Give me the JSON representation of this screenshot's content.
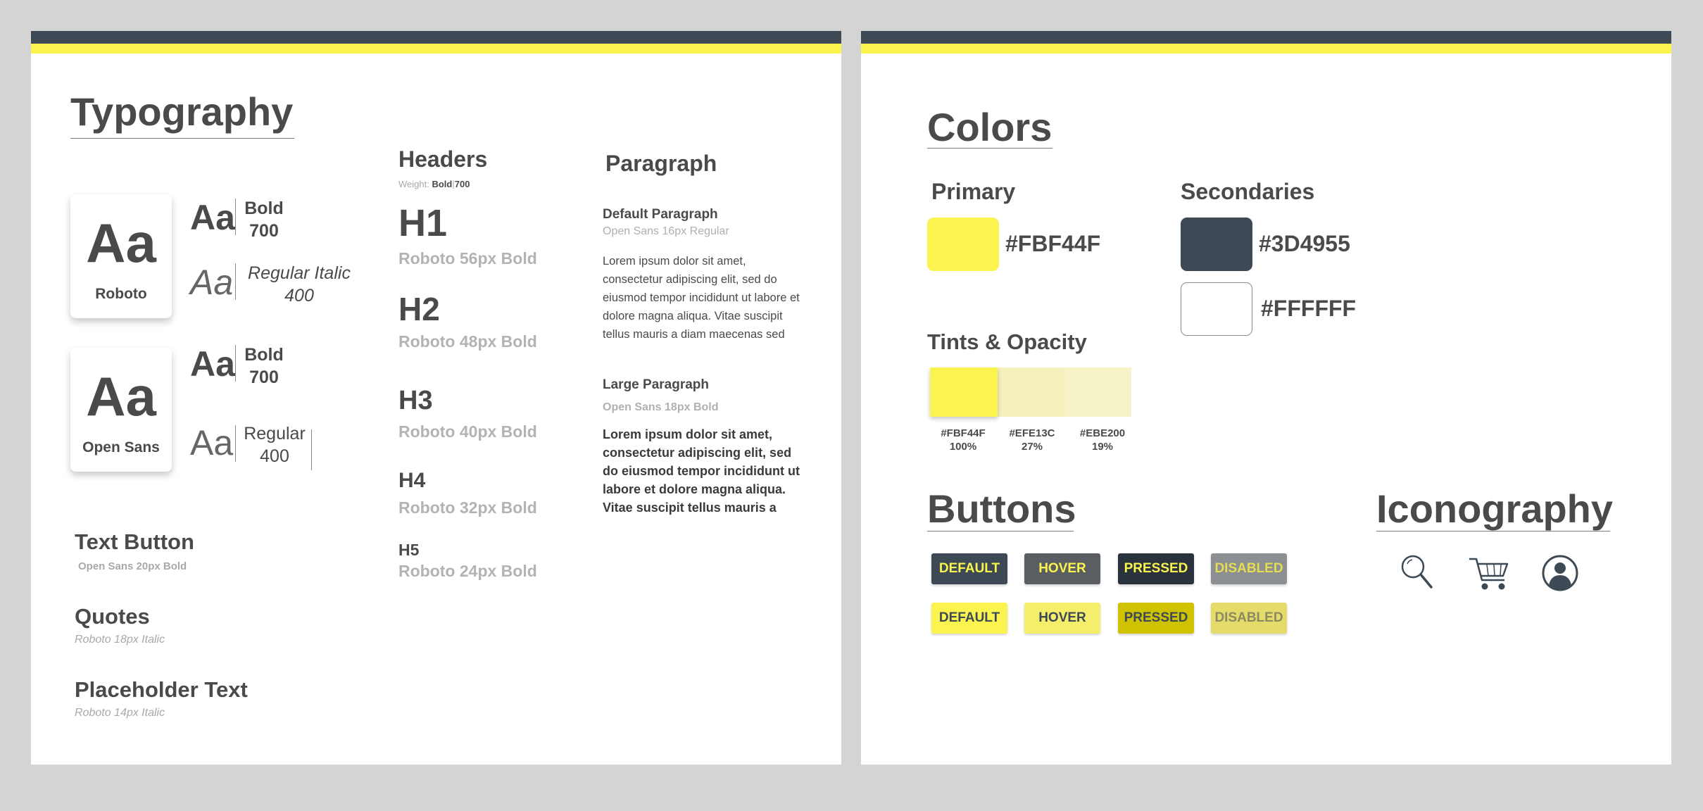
{
  "typography": {
    "title": "Typography",
    "fonts": [
      {
        "sample": "Aa",
        "name": "Roboto",
        "weights": [
          {
            "sample": "Aa",
            "line1": "Bold",
            "line2": "700"
          },
          {
            "sample": "Aa",
            "line1": "Regular Italic",
            "line2": "400"
          }
        ]
      },
      {
        "sample": "Aa",
        "name": "Open Sans",
        "weights": [
          {
            "sample": "Aa",
            "line1": "Bold",
            "line2": "700"
          },
          {
            "sample": "Aa",
            "line1": "Regular",
            "line2": "400"
          }
        ]
      }
    ],
    "text_button": {
      "title": "Text Button",
      "sub": "Open Sans 20px Bold"
    },
    "quotes": {
      "title": "Quotes",
      "sub": "Roboto 18px Italic"
    },
    "placeholder": {
      "title": "Placeholder Text",
      "sub": "Roboto 14px Italic"
    }
  },
  "headers": {
    "title": "Headers",
    "weight_label": "Weight:",
    "weight_bold": "Bold",
    "weight_num": "700",
    "items": [
      {
        "tag": "H1",
        "spec": "Roboto 56px Bold"
      },
      {
        "tag": "H2",
        "spec": "Roboto 48px Bold"
      },
      {
        "tag": "H3",
        "spec": "Roboto 40px Bold"
      },
      {
        "tag": "H4",
        "spec": "Roboto 32px Bold"
      },
      {
        "tag": "H5",
        "spec": "Roboto 24px Bold"
      }
    ]
  },
  "paragraph": {
    "title": "Paragraph",
    "default": {
      "title": "Default Paragraph",
      "sub": "Open Sans 16px Regular",
      "lines": [
        "Lorem ipsum dolor sit amet,",
        "consectetur adipiscing elit, sed do",
        "eiusmod tempor incididunt ut labore et",
        "dolore magna aliqua. Vitae suscipit",
        "tellus mauris a diam maecenas sed"
      ]
    },
    "large": {
      "title": "Large Paragraph",
      "sub": "Open Sans 18px Bold",
      "lines": [
        "Lorem ipsum dolor sit amet,",
        "consectetur adipiscing elit, sed",
        "do eiusmod tempor incididunt ut",
        "labore et dolore magna aliqua.",
        "Vitae suscipit tellus mauris a"
      ]
    }
  },
  "colors": {
    "title": "Colors",
    "primary": {
      "title": "Primary",
      "hex": "#FBF44F",
      "color": "#FBF44F"
    },
    "secondaries": {
      "title": "Secondaries",
      "items": [
        {
          "hex": "#3D4955",
          "color": "#3D4955"
        },
        {
          "hex": "#FFFFFF",
          "color": "#FFFFFF"
        }
      ]
    },
    "tints": {
      "title": "Tints & Opacity",
      "items": [
        {
          "hex": "#FBF44F",
          "pct": "100%",
          "color": "#FBF44F"
        },
        {
          "hex": "#EFE13C",
          "pct": "27%",
          "color": "#F5F0BE"
        },
        {
          "hex": "#EBE200",
          "pct": "19%",
          "color": "#F6F3C6"
        }
      ]
    }
  },
  "buttons": {
    "title": "Buttons",
    "dark_row": [
      {
        "label": "DEFAULT",
        "bg": "#3D4955",
        "fg": "#FBF44F"
      },
      {
        "label": "HOVER",
        "bg": "#5A5D62",
        "fg": "#FBF44F"
      },
      {
        "label": "PRESSED",
        "bg": "#2A333D",
        "fg": "#FBF44F"
      },
      {
        "label": "DISABLED",
        "bg": "#8C8F94",
        "fg": "#E5DC50"
      }
    ],
    "light_row": [
      {
        "label": "DEFAULT",
        "bg": "#FBF44F",
        "fg": "#3D4955"
      },
      {
        "label": "HOVER",
        "bg": "#F5EE6A",
        "fg": "#3D4955"
      },
      {
        "label": "PRESSED",
        "bg": "#CFC200",
        "fg": "#3D4955"
      },
      {
        "label": "DISABLED",
        "bg": "#E5DB6A",
        "fg": "#8C8A60"
      }
    ]
  },
  "iconography": {
    "title": "Iconography",
    "icons": [
      "search-icon",
      "cart-icon",
      "user-icon"
    ]
  }
}
